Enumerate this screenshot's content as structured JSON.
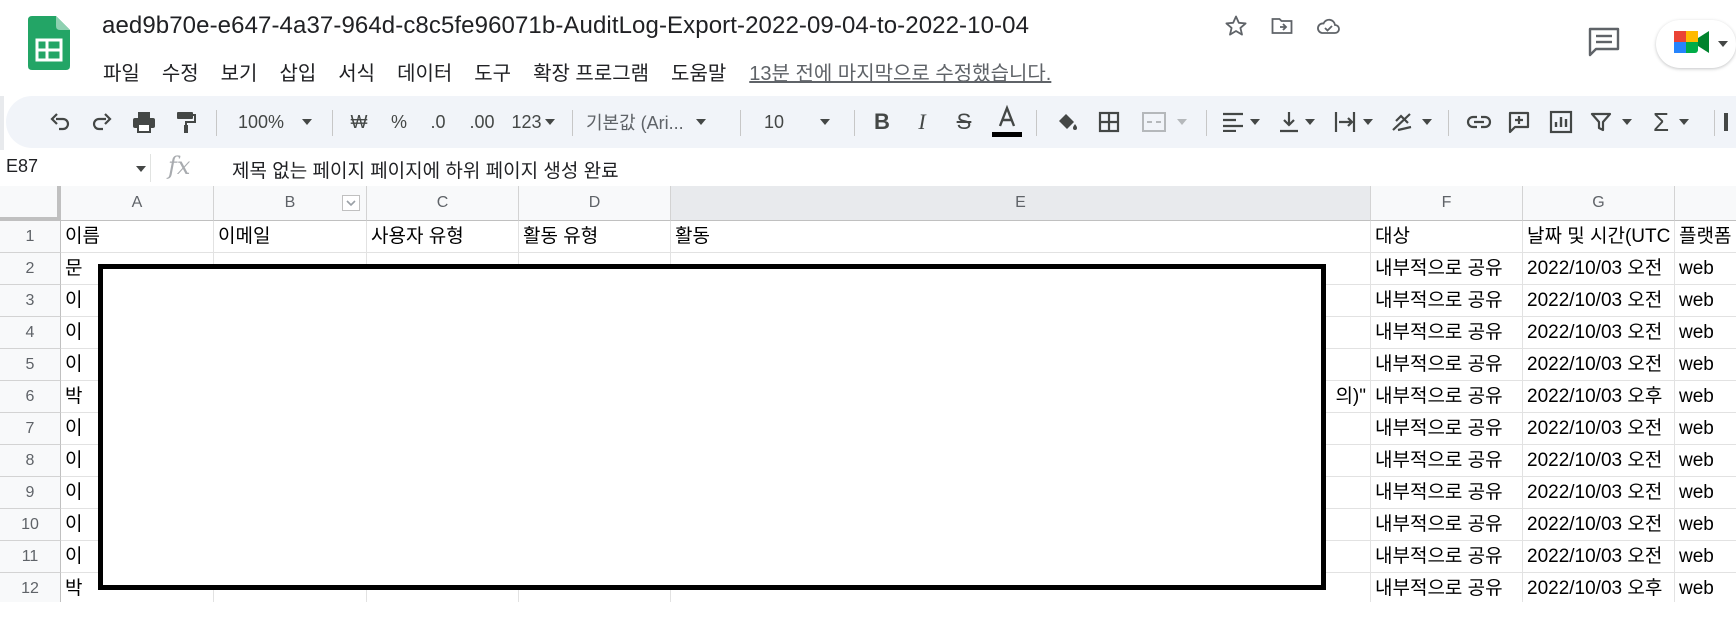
{
  "doc": {
    "title": "aed9b70e-e647-4a37-964d-c8c5fe96071b-AuditLog-Export-2022-09-04-to-2022-10-04",
    "last_edit": "13분 전에 마지막으로 수정했습니다."
  },
  "menu": [
    "파일",
    "수정",
    "보기",
    "삽입",
    "서식",
    "데이터",
    "도구",
    "확장 프로그램",
    "도움말"
  ],
  "toolbar": {
    "zoom": "100%",
    "currency": "₩",
    "percent": "%",
    "dec_decrease": ".0",
    "dec_increase": ".00",
    "more_formats": "123",
    "font": "기본값 (Ari...",
    "font_size": "10"
  },
  "formula_bar": {
    "cell_ref": "E87",
    "fx": "fx",
    "content": "제목 없는 페이지 페이지에 하위 페이지 생성 완료"
  },
  "columns": [
    "A",
    "B",
    "C",
    "D",
    "E",
    "F",
    "G"
  ],
  "rows": [
    "1",
    "2",
    "3",
    "4",
    "5",
    "6",
    "7",
    "8",
    "9",
    "10",
    "11",
    "12"
  ],
  "header_row": [
    "이름",
    "이메일",
    "사용자 유형",
    "활동 유형",
    "활동",
    "대상",
    "날짜 및 시간(UTC",
    "플랫폼"
  ],
  "visible_cells": {
    "A": [
      "문",
      "이",
      "이",
      "이",
      "박",
      "이",
      "이",
      "이",
      "이",
      "이",
      "박"
    ],
    "E6": "의)\"",
    "F": [
      "내부적으로 공유",
      "내부적으로 공유",
      "내부적으로 공유",
      "내부적으로 공유",
      "내부적으로 공유",
      "내부적으로 공유",
      "내부적으로 공유",
      "내부적으로 공유",
      "내부적으로 공유",
      "내부적으로 공유",
      "내부적으로 공유"
    ],
    "G": [
      "2022/10/03 오전",
      "2022/10/03 오전",
      "2022/10/03 오전",
      "2022/10/03 오전",
      "2022/10/03 오후",
      "2022/10/03 오전",
      "2022/10/03 오전",
      "2022/10/03 오전",
      "2022/10/03 오전",
      "2022/10/03 오전",
      "2022/10/03 오후"
    ],
    "H": [
      "web",
      "web",
      "web",
      "web",
      "web",
      "web",
      "web",
      "web",
      "web",
      "web",
      "web"
    ]
  },
  "colors": {
    "sheets_green": "#23a566",
    "toolbar_bg": "#f1f4f9",
    "header_bg": "#f8f9fa"
  }
}
